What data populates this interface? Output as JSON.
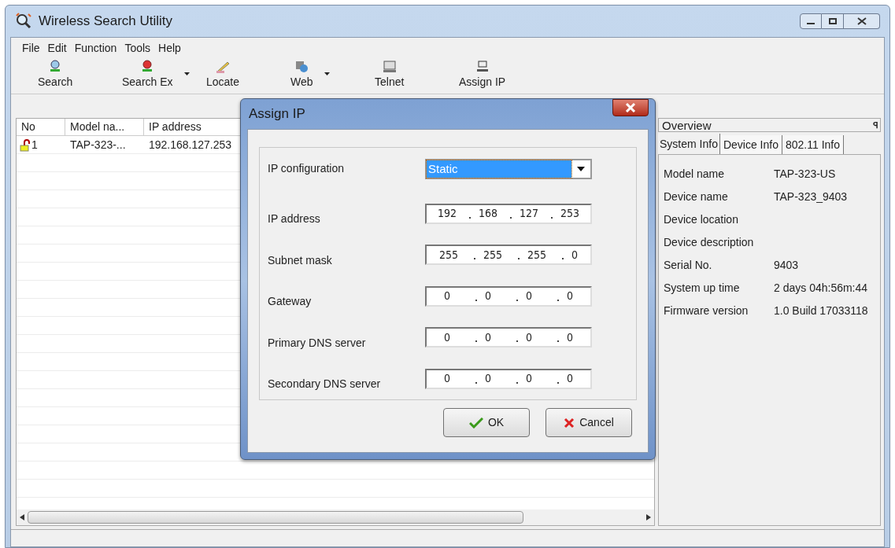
{
  "window": {
    "title": "Wireless Search Utility"
  },
  "menu": [
    "File",
    "Edit",
    "Function",
    "Tools",
    "Help"
  ],
  "toolbar": [
    {
      "label": "Search",
      "has_dropdown": false
    },
    {
      "label": "Search Ex",
      "has_dropdown": true
    },
    {
      "label": "Locate",
      "has_dropdown": false
    },
    {
      "label": "Web",
      "has_dropdown": true
    },
    {
      "label": "Telnet",
      "has_dropdown": false
    },
    {
      "label": "Assign IP",
      "has_dropdown": false
    }
  ],
  "table": {
    "columns": [
      "No",
      "Model na...",
      "IP address"
    ],
    "rows": [
      {
        "no": "1",
        "locked": false,
        "model": "TAP-323-...",
        "ip": "192.168.127.253"
      }
    ]
  },
  "overview": {
    "title": "Overview",
    "pin": "ꟼ",
    "tabs": [
      {
        "label": "System Info",
        "selected": true
      },
      {
        "label": "Device Info",
        "selected": false
      },
      {
        "label": "802.11 Info",
        "selected": false
      }
    ],
    "rows": [
      {
        "label": "Model name",
        "value": "TAP-323-US"
      },
      {
        "label": "Device name",
        "value": "TAP-323_9403"
      },
      {
        "label": "Device location"
      },
      {
        "label": "Device description"
      },
      {
        "label": "Serial No.",
        "value": "9403"
      },
      {
        "label": "System up time",
        "value": "2 days 04h:56m:44"
      },
      {
        "label": "Firmware version",
        "value": "1.0 Build 17033118"
      }
    ]
  },
  "dialog": {
    "title": "Assign IP",
    "fields": [
      {
        "label": "IP configuration",
        "kind": "dropdown",
        "value": "Static"
      },
      {
        "label": "IP address",
        "kind": "ip",
        "octets": [
          "192",
          "168",
          "127",
          "253"
        ]
      },
      {
        "label": "Subnet mask",
        "kind": "ip",
        "octets": [
          "255",
          "255",
          "255",
          "0"
        ]
      },
      {
        "label": "Gateway",
        "kind": "ip",
        "octets": [
          "0",
          "0",
          "0",
          "0"
        ]
      },
      {
        "label": "Primary DNS server",
        "kind": "ip",
        "octets": [
          "0",
          "0",
          "0",
          "0"
        ]
      },
      {
        "label": "Secondary DNS server",
        "kind": "ip",
        "octets": [
          "0",
          "0",
          "0",
          "0"
        ]
      }
    ],
    "buttons": [
      {
        "label": "OK",
        "kind": "ok"
      },
      {
        "label": "Cancel",
        "kind": "cancel"
      }
    ]
  }
}
